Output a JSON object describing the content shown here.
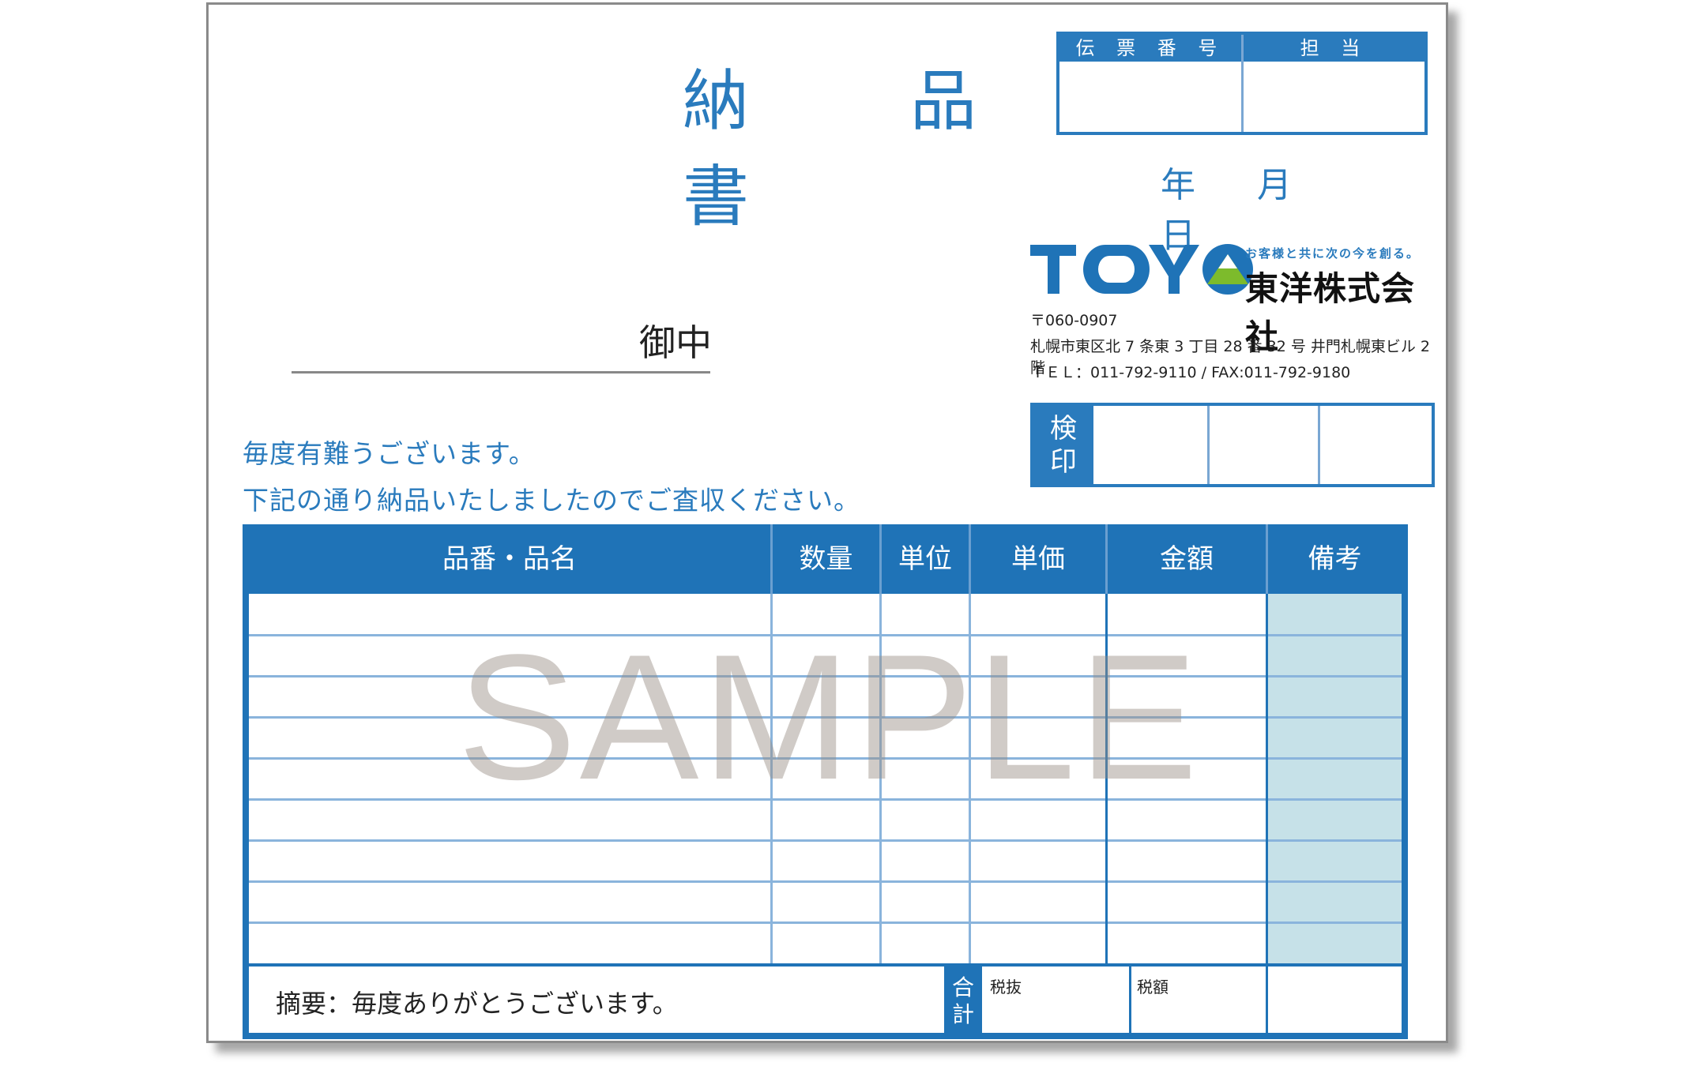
{
  "document": {
    "title": "納　品　書",
    "slip_number_label": "伝 票 番 号",
    "person_label": "担 当",
    "date_labels": [
      "年",
      "月",
      "日"
    ]
  },
  "company": {
    "logo_text": "TOYO",
    "tagline": "お客様と共に次の今を創る。",
    "name": "東洋株式会社",
    "postal": "〒060-0907",
    "address": "札幌市東区北 7 条東 3 丁目 28 番 32 号 井門札幌東ビル 2 階",
    "tel": "ＴＥＬ：011-792-9110 / FAX:011-792-9180",
    "brand_blue": "#1f73b7",
    "brand_green": "#7dbb2c"
  },
  "inspection": {
    "label_line1": "検",
    "label_line2": "印"
  },
  "addressee": {
    "suffix": "御中"
  },
  "greeting": {
    "line1": "毎度有難うございます。",
    "line2": "下記の通り納品いたしましたのでご査収ください。"
  },
  "table": {
    "headers": [
      "品番・品名",
      "数量",
      "単位",
      "単価",
      "金額",
      "備考"
    ],
    "row_count": 9,
    "watermark": "SAMPLE"
  },
  "footer": {
    "summary": "摘要：毎度ありがとうございます。",
    "total_label_line1": "合",
    "total_label_line2": "計",
    "tax_excluded_label": "税抜",
    "tax_amount_label": "税額"
  }
}
